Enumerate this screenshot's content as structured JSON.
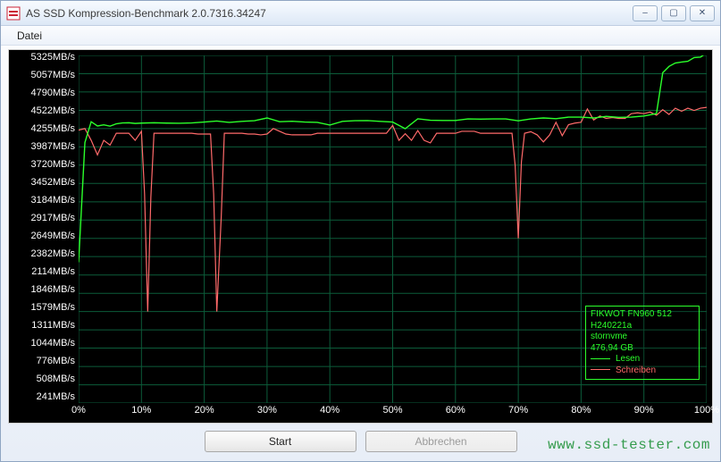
{
  "window": {
    "title": "AS SSD Kompression-Benchmark 2.0.7316.34247",
    "icon_name": "app-icon"
  },
  "window_controls": {
    "minimize": "–",
    "maximize": "▢",
    "close": "✕"
  },
  "menu": {
    "file": "Datei"
  },
  "chart_data": {
    "type": "line",
    "xlabel": "",
    "ylabel": "",
    "x_unit": "%",
    "y_unit": "MB/s",
    "xlim": [
      0,
      100
    ],
    "ylim": [
      241,
      5325
    ],
    "y_ticks": [
      5325,
      5057,
      4790,
      4522,
      4255,
      3987,
      3720,
      3452,
      3184,
      2917,
      2649,
      2382,
      2114,
      1846,
      1579,
      1311,
      1044,
      776,
      508,
      241
    ],
    "x_ticks": [
      0,
      10,
      20,
      30,
      40,
      50,
      60,
      70,
      80,
      90,
      100
    ],
    "series": [
      {
        "name": "Lesen",
        "color": "#2bff2b",
        "values": [
          [
            0,
            2300
          ],
          [
            1,
            4050
          ],
          [
            2,
            4355
          ],
          [
            3,
            4293
          ],
          [
            4,
            4310
          ],
          [
            5,
            4290
          ],
          [
            6,
            4325
          ],
          [
            7,
            4338
          ],
          [
            8,
            4340
          ],
          [
            9,
            4330
          ],
          [
            10,
            4335
          ],
          [
            12,
            4340
          ],
          [
            14,
            4335
          ],
          [
            16,
            4332
          ],
          [
            18,
            4338
          ],
          [
            20,
            4350
          ],
          [
            22,
            4365
          ],
          [
            24,
            4345
          ],
          [
            26,
            4360
          ],
          [
            28,
            4370
          ],
          [
            30,
            4410
          ],
          [
            32,
            4355
          ],
          [
            34,
            4362
          ],
          [
            36,
            4350
          ],
          [
            38,
            4345
          ],
          [
            40,
            4307
          ],
          [
            42,
            4360
          ],
          [
            44,
            4370
          ],
          [
            46,
            4372
          ],
          [
            48,
            4360
          ],
          [
            50,
            4350
          ],
          [
            52,
            4253
          ],
          [
            54,
            4398
          ],
          [
            56,
            4376
          ],
          [
            58,
            4373
          ],
          [
            60,
            4373
          ],
          [
            62,
            4396
          ],
          [
            64,
            4393
          ],
          [
            66,
            4396
          ],
          [
            68,
            4396
          ],
          [
            70,
            4368
          ],
          [
            72,
            4396
          ],
          [
            74,
            4410
          ],
          [
            76,
            4399
          ],
          [
            78,
            4422
          ],
          [
            80,
            4422
          ],
          [
            82,
            4410
          ],
          [
            84,
            4433
          ],
          [
            86,
            4419
          ],
          [
            88,
            4422
          ],
          [
            90,
            4439
          ],
          [
            92,
            4474
          ],
          [
            93,
            5072
          ],
          [
            94,
            5164
          ],
          [
            95,
            5213
          ],
          [
            96,
            5228
          ],
          [
            97,
            5239
          ],
          [
            98,
            5293
          ],
          [
            99,
            5299
          ],
          [
            100,
            5362
          ]
        ]
      },
      {
        "name": "Schreiben",
        "color": "#ff6a6a",
        "values": [
          [
            0,
            4232
          ],
          [
            1,
            4255
          ],
          [
            2,
            4083
          ],
          [
            3,
            3870
          ],
          [
            4,
            4083
          ],
          [
            5,
            4013
          ],
          [
            6,
            4186
          ],
          [
            7,
            4186
          ],
          [
            8,
            4186
          ],
          [
            9,
            4083
          ],
          [
            10,
            4215
          ],
          [
            10.5,
            3300
          ],
          [
            11,
            1579
          ],
          [
            11.5,
            3250
          ],
          [
            12,
            4186
          ],
          [
            13,
            4186
          ],
          [
            14,
            4186
          ],
          [
            15,
            4186
          ],
          [
            16,
            4186
          ],
          [
            17,
            4186
          ],
          [
            18,
            4186
          ],
          [
            19,
            4175
          ],
          [
            20,
            4175
          ],
          [
            21,
            4175
          ],
          [
            21.5,
            3300
          ],
          [
            22,
            1579
          ],
          [
            22.7,
            2950
          ],
          [
            23.2,
            4186
          ],
          [
            24,
            4186
          ],
          [
            25,
            4186
          ],
          [
            26,
            4186
          ],
          [
            27,
            4175
          ],
          [
            28,
            4175
          ],
          [
            29,
            4163
          ],
          [
            30,
            4175
          ],
          [
            31,
            4255
          ],
          [
            32,
            4215
          ],
          [
            33,
            4175
          ],
          [
            34,
            4163
          ],
          [
            35,
            4163
          ],
          [
            36,
            4163
          ],
          [
            37,
            4163
          ],
          [
            38,
            4186
          ],
          [
            39,
            4186
          ],
          [
            40,
            4186
          ],
          [
            41,
            4186
          ],
          [
            42,
            4186
          ],
          [
            43,
            4186
          ],
          [
            44,
            4186
          ],
          [
            45,
            4186
          ],
          [
            46,
            4186
          ],
          [
            47,
            4186
          ],
          [
            48,
            4186
          ],
          [
            49,
            4186
          ],
          [
            50,
            4301
          ],
          [
            51,
            4083
          ],
          [
            52,
            4180
          ],
          [
            53,
            4083
          ],
          [
            54,
            4226
          ],
          [
            55,
            4083
          ],
          [
            56,
            4045
          ],
          [
            57,
            4186
          ],
          [
            58,
            4186
          ],
          [
            59,
            4186
          ],
          [
            60,
            4186
          ],
          [
            61,
            4215
          ],
          [
            62,
            4215
          ],
          [
            63,
            4215
          ],
          [
            64,
            4186
          ],
          [
            65,
            4186
          ],
          [
            66,
            4186
          ],
          [
            67,
            4186
          ],
          [
            68,
            4186
          ],
          [
            69,
            4186
          ],
          [
            69.5,
            3720
          ],
          [
            70,
            2649
          ],
          [
            70.5,
            3770
          ],
          [
            71,
            4186
          ],
          [
            72,
            4209
          ],
          [
            73,
            4163
          ],
          [
            74,
            4060
          ],
          [
            75,
            4163
          ],
          [
            76,
            4347
          ],
          [
            77,
            4151
          ],
          [
            78,
            4312
          ],
          [
            79,
            4335
          ],
          [
            80,
            4347
          ],
          [
            81,
            4542
          ],
          [
            82,
            4381
          ],
          [
            83,
            4439
          ],
          [
            84,
            4404
          ],
          [
            85,
            4416
          ],
          [
            86,
            4404
          ],
          [
            87,
            4404
          ],
          [
            88,
            4473
          ],
          [
            89,
            4485
          ],
          [
            90,
            4473
          ],
          [
            91,
            4496
          ],
          [
            92,
            4450
          ],
          [
            93,
            4530
          ],
          [
            94,
            4462
          ],
          [
            95,
            4553
          ],
          [
            96,
            4508
          ],
          [
            97,
            4553
          ],
          [
            98,
            4519
          ],
          [
            99,
            4553
          ],
          [
            100,
            4565
          ]
        ]
      }
    ],
    "legend": {
      "device": "FIKWOT FN960 512",
      "firmware": "H240221a",
      "driver": "stornvme",
      "capacity": "476,94 GB",
      "read_label": "Lesen",
      "write_label": "Schreiben"
    }
  },
  "buttons": {
    "start": "Start",
    "cancel": "Abbrechen"
  },
  "watermark": "www.ssd-tester.com"
}
